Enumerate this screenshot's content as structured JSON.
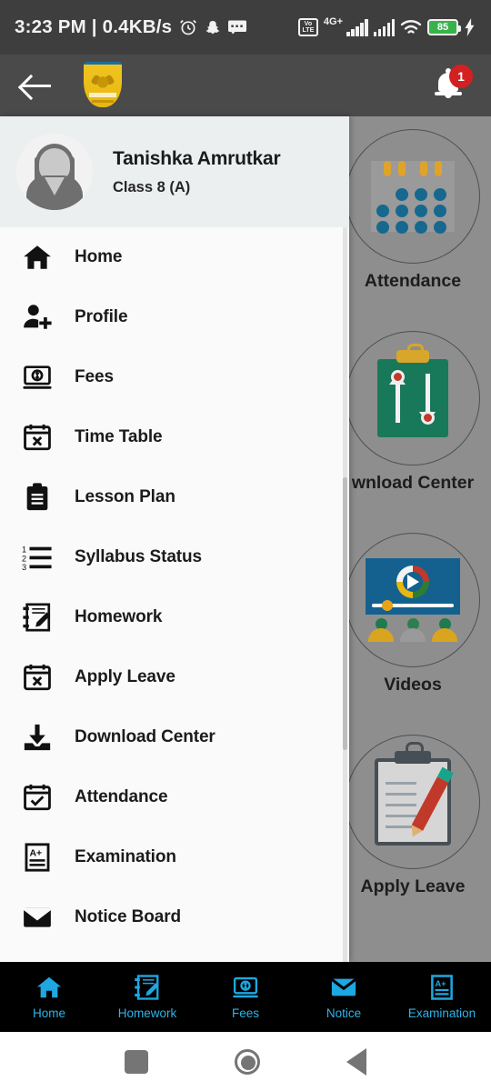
{
  "status_bar": {
    "time_and_data": "3:23 PM | 0.4KB/s",
    "icons_left": [
      "alarm-icon",
      "snapchat-icon",
      "message-icon"
    ],
    "network_type": "4G+",
    "volte_line1": "Vo",
    "volte_line2": "LTE",
    "battery_percent": "85",
    "charging": true,
    "background": "#3e3e3e"
  },
  "app_bar": {
    "back_label": "Back",
    "logo_name": "school-crest-logo",
    "notification_badge": "1",
    "background": "#4a4a4a"
  },
  "drawer": {
    "profile": {
      "name": "Tanishka Amrutkar",
      "class": "Class 8 (A)"
    },
    "items": [
      {
        "label": "Home",
        "icon": "home-icon"
      },
      {
        "label": "Profile",
        "icon": "person-add-icon"
      },
      {
        "label": "Fees",
        "icon": "money-laptop-icon"
      },
      {
        "label": "Time Table",
        "icon": "calendar-x-icon"
      },
      {
        "label": "Lesson Plan",
        "icon": "clipboard-icon"
      },
      {
        "label": "Syllabus Status",
        "icon": "numbered-list-icon"
      },
      {
        "label": "Homework",
        "icon": "notebook-pen-icon"
      },
      {
        "label": "Apply Leave",
        "icon": "calendar-x-icon"
      },
      {
        "label": "Download Center",
        "icon": "download-icon"
      },
      {
        "label": "Attendance",
        "icon": "calendar-check-icon"
      },
      {
        "label": "Examination",
        "icon": "exam-paper-icon"
      },
      {
        "label": "Notice Board",
        "icon": "envelope-icon"
      }
    ]
  },
  "background_tiles": [
    {
      "label": "Attendance",
      "art": "calendar-art"
    },
    {
      "label": "wnload Center",
      "art": "download-clipboard-art"
    },
    {
      "label": "Videos",
      "art": "video-player-art"
    },
    {
      "label": "Apply Leave",
      "art": "clipboard-pencil-art"
    }
  ],
  "bottom_nav": {
    "active_index": 0,
    "accent_color": "#2fb4e8",
    "items": [
      {
        "label": "Home",
        "icon": "home-icon"
      },
      {
        "label": "Homework",
        "icon": "notebook-pen-icon"
      },
      {
        "label": "Fees",
        "icon": "money-laptop-icon"
      },
      {
        "label": "Notice",
        "icon": "envelope-icon"
      },
      {
        "label": "Examination",
        "icon": "exam-paper-icon"
      }
    ]
  },
  "android_nav": {
    "recents": "square-recents-icon",
    "home": "circle-home-icon",
    "back": "triangle-back-icon"
  }
}
